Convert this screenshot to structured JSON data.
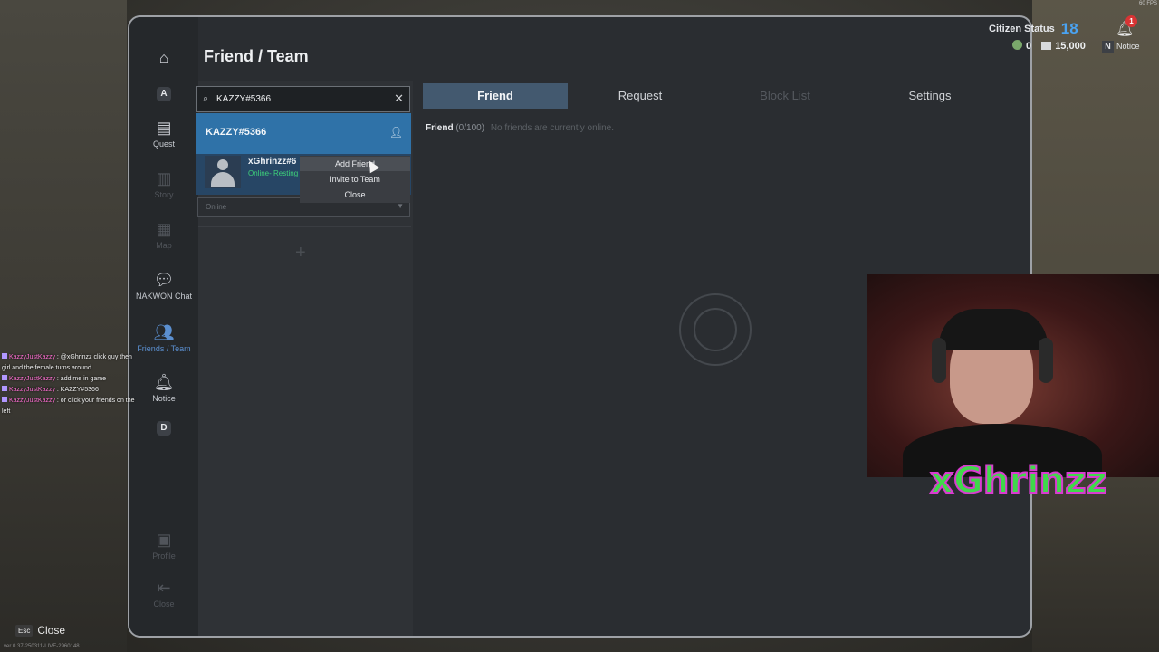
{
  "window": {
    "title": "Friend / Team"
  },
  "sidebar": {
    "items": [
      {
        "label": "",
        "badge": "",
        "icon": "home-icon"
      },
      {
        "label": "",
        "badge": "A",
        "icon": ""
      },
      {
        "label": "Quest",
        "badge": "",
        "icon": "quest-document-icon"
      },
      {
        "label": "Story",
        "badge": "",
        "icon": "story-book-icon"
      },
      {
        "label": "Map",
        "badge": "",
        "icon": "map-icon"
      },
      {
        "label": "NAKWON Chat",
        "badge": "",
        "icon": "chat-bubble-icon"
      },
      {
        "label": "Friends / Team",
        "badge": "",
        "icon": "people-icon"
      },
      {
        "label": "Notice",
        "badge": "",
        "icon": "bell-icon"
      },
      {
        "label": "",
        "badge": "D",
        "icon": ""
      },
      {
        "label": "Profile",
        "badge": "",
        "icon": "profile-card-icon"
      },
      {
        "label": "Close",
        "badge": "",
        "icon": "exit-icon"
      }
    ]
  },
  "search": {
    "value": "KAZZY#5366"
  },
  "search_result": {
    "name": "KAZZY#5366"
  },
  "result_user": {
    "name": "xGhrinzz#6",
    "status": "Online- Resting"
  },
  "online_filter": {
    "label": "Online"
  },
  "context_menu": {
    "items": [
      "Add Friend",
      "Invite to Team",
      "Close"
    ]
  },
  "tabs": [
    "Friend",
    "Request",
    "Block List",
    "Settings"
  ],
  "friend_list": {
    "label": "Friend",
    "count": "(0/100)",
    "message": "No friends are currently online."
  },
  "hud": {
    "citizen_label": "Citizen Status",
    "citizen_level": "18",
    "notification_count": "1",
    "gems": "0",
    "cash": "15,000",
    "notice_key": "N",
    "notice_label": "Notice",
    "fps": "60 FPS"
  },
  "chat": [
    {
      "user": "KazzyJustKazzy",
      "text": ": @xGhrinzz click guy then girl and the female turns around"
    },
    {
      "user": "KazzyJustKazzy",
      "text": ": add me in game"
    },
    {
      "user": "KazzyJustKazzy",
      "text": ": KAZZY#5366"
    },
    {
      "user": "KazzyJustKazzy",
      "text": ": or click your friends on the left"
    }
  ],
  "footer": {
    "esc_key": "Esc",
    "esc_label": "Close",
    "version": "ver 0.37-250311-LIVE-2960148"
  },
  "stream_logo": {
    "text": "xGhrinzz"
  },
  "colors": {
    "accent": "#2f72a8",
    "active_nav": "#5b8fd0",
    "online": "#3ed07a",
    "level": "#4aa3f2",
    "chat_user": "#ff6fd3"
  }
}
